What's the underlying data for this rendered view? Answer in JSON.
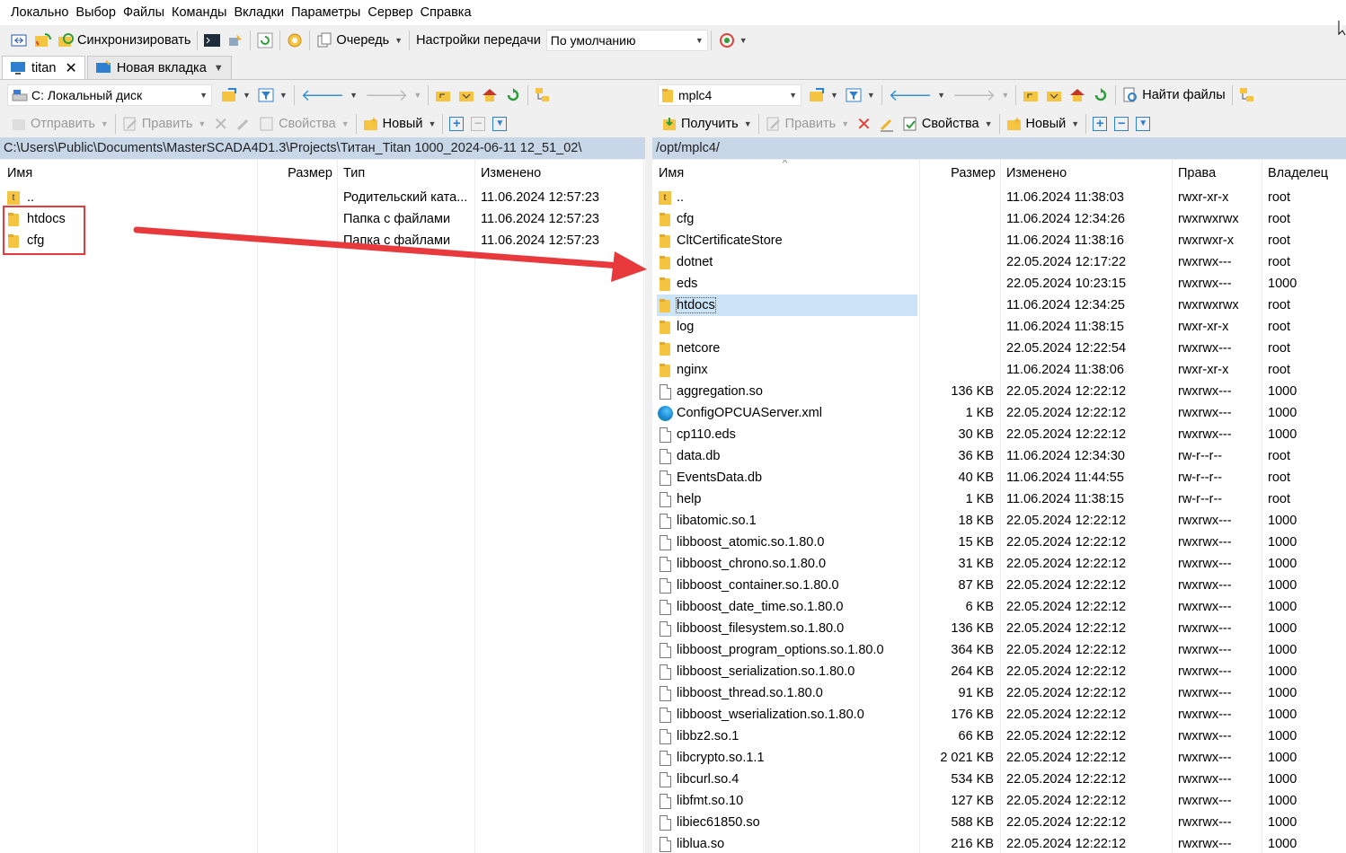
{
  "menu": [
    "Локально",
    "Выбор",
    "Файлы",
    "Команды",
    "Вкладки",
    "Параметры",
    "Сервер",
    "Справка"
  ],
  "main_toolbar": {
    "sync_label": "Синхронизировать",
    "queue_label": "Очередь",
    "transfer_settings_label": "Настройки передачи",
    "transfer_preset": "По умолчанию"
  },
  "tabs": [
    {
      "label": "titan",
      "active": true
    },
    {
      "label": "Новая вкладка",
      "active": false
    }
  ],
  "left": {
    "drive": "C: Локальный диск",
    "send_label": "Отправить",
    "edit_label": "Править",
    "properties_label": "Свойства",
    "new_label": "Новый",
    "path": "C:\\Users\\Public\\Documents\\MasterSCADA4D1.3\\Projects\\Титан_Titan 1000_2024-06-11 12_51_02\\",
    "columns": [
      "Имя",
      "Размер",
      "Тип",
      "Изменено"
    ],
    "rows": [
      {
        "icon": "up-folder-icon",
        "name": "..",
        "size": "",
        "type": "Родительский ката...",
        "modified": "11.06.2024 12:57:23"
      },
      {
        "icon": "folder-icon",
        "name": "htdocs",
        "size": "",
        "type": "Папка с файлами",
        "modified": "11.06.2024 12:57:23"
      },
      {
        "icon": "folder-icon",
        "name": "cfg",
        "size": "",
        "type": "Папка с файлами",
        "modified": "11.06.2024 12:57:23"
      }
    ]
  },
  "right": {
    "folder": "mplc4",
    "find_files_label": "Найти файлы",
    "receive_label": "Получить",
    "edit_label": "Править",
    "properties_label": "Свойства",
    "new_label": "Новый",
    "path": "/opt/mplc4/",
    "columns": [
      "Имя",
      "Размер",
      "Изменено",
      "Права",
      "Владелец"
    ],
    "rows": [
      {
        "icon": "up-folder-icon",
        "name": "..",
        "size": "",
        "modified": "11.06.2024 11:38:03",
        "rights": "rwxr-xr-x",
        "owner": "root"
      },
      {
        "icon": "folder-icon",
        "name": "cfg",
        "size": "",
        "modified": "11.06.2024 12:34:26",
        "rights": "rwxrwxrwx",
        "owner": "root"
      },
      {
        "icon": "folder-icon",
        "name": "CltCertificateStore",
        "size": "",
        "modified": "11.06.2024 11:38:16",
        "rights": "rwxrwxr-x",
        "owner": "root"
      },
      {
        "icon": "folder-icon",
        "name": "dotnet",
        "size": "",
        "modified": "22.05.2024 12:17:22",
        "rights": "rwxrwx---",
        "owner": "root"
      },
      {
        "icon": "folder-icon",
        "name": "eds",
        "size": "",
        "modified": "22.05.2024 10:23:15",
        "rights": "rwxrwx---",
        "owner": "1000"
      },
      {
        "icon": "folder-icon",
        "name": "htdocs",
        "size": "",
        "modified": "11.06.2024 12:34:25",
        "rights": "rwxrwxrwx",
        "owner": "root",
        "selected": true
      },
      {
        "icon": "folder-icon",
        "name": "log",
        "size": "",
        "modified": "11.06.2024 11:38:15",
        "rights": "rwxr-xr-x",
        "owner": "root"
      },
      {
        "icon": "folder-icon",
        "name": "netcore",
        "size": "",
        "modified": "22.05.2024 12:22:54",
        "rights": "rwxrwx---",
        "owner": "root"
      },
      {
        "icon": "folder-icon",
        "name": "nginx",
        "size": "",
        "modified": "11.06.2024 11:38:06",
        "rights": "rwxr-xr-x",
        "owner": "root"
      },
      {
        "icon": "file-icon",
        "name": "aggregation.so",
        "size": "136 KB",
        "modified": "22.05.2024 12:22:12",
        "rights": "rwxrwx---",
        "owner": "1000"
      },
      {
        "icon": "edge-icon",
        "name": "ConfigOPCUAServer.xml",
        "size": "1 KB",
        "modified": "22.05.2024 12:22:12",
        "rights": "rwxrwx---",
        "owner": "1000"
      },
      {
        "icon": "file-icon",
        "name": "cp110.eds",
        "size": "30 KB",
        "modified": "22.05.2024 12:22:12",
        "rights": "rwxrwx---",
        "owner": "1000"
      },
      {
        "icon": "file-icon",
        "name": "data.db",
        "size": "36 KB",
        "modified": "11.06.2024 12:34:30",
        "rights": "rw-r--r--",
        "owner": "root"
      },
      {
        "icon": "file-icon",
        "name": "EventsData.db",
        "size": "40 KB",
        "modified": "11.06.2024 11:44:55",
        "rights": "rw-r--r--",
        "owner": "root"
      },
      {
        "icon": "file-icon",
        "name": "help",
        "size": "1 KB",
        "modified": "11.06.2024 11:38:15",
        "rights": "rw-r--r--",
        "owner": "root"
      },
      {
        "icon": "file-icon",
        "name": "libatomic.so.1",
        "size": "18 KB",
        "modified": "22.05.2024 12:22:12",
        "rights": "rwxrwx---",
        "owner": "1000"
      },
      {
        "icon": "file-icon",
        "name": "libboost_atomic.so.1.80.0",
        "size": "15 KB",
        "modified": "22.05.2024 12:22:12",
        "rights": "rwxrwx---",
        "owner": "1000"
      },
      {
        "icon": "file-icon",
        "name": "libboost_chrono.so.1.80.0",
        "size": "31 KB",
        "modified": "22.05.2024 12:22:12",
        "rights": "rwxrwx---",
        "owner": "1000"
      },
      {
        "icon": "file-icon",
        "name": "libboost_container.so.1.80.0",
        "size": "87 KB",
        "modified": "22.05.2024 12:22:12",
        "rights": "rwxrwx---",
        "owner": "1000"
      },
      {
        "icon": "file-icon",
        "name": "libboost_date_time.so.1.80.0",
        "size": "6 KB",
        "modified": "22.05.2024 12:22:12",
        "rights": "rwxrwx---",
        "owner": "1000"
      },
      {
        "icon": "file-icon",
        "name": "libboost_filesystem.so.1.80.0",
        "size": "136 KB",
        "modified": "22.05.2024 12:22:12",
        "rights": "rwxrwx---",
        "owner": "1000"
      },
      {
        "icon": "file-icon",
        "name": "libboost_program_options.so.1.80.0",
        "size": "364 KB",
        "modified": "22.05.2024 12:22:12",
        "rights": "rwxrwx---",
        "owner": "1000"
      },
      {
        "icon": "file-icon",
        "name": "libboost_serialization.so.1.80.0",
        "size": "264 KB",
        "modified": "22.05.2024 12:22:12",
        "rights": "rwxrwx---",
        "owner": "1000"
      },
      {
        "icon": "file-icon",
        "name": "libboost_thread.so.1.80.0",
        "size": "91 KB",
        "modified": "22.05.2024 12:22:12",
        "rights": "rwxrwx---",
        "owner": "1000"
      },
      {
        "icon": "file-icon",
        "name": "libboost_wserialization.so.1.80.0",
        "size": "176 KB",
        "modified": "22.05.2024 12:22:12",
        "rights": "rwxrwx---",
        "owner": "1000"
      },
      {
        "icon": "file-icon",
        "name": "libbz2.so.1",
        "size": "66 KB",
        "modified": "22.05.2024 12:22:12",
        "rights": "rwxrwx---",
        "owner": "1000"
      },
      {
        "icon": "file-icon",
        "name": "libcrypto.so.1.1",
        "size": "2 021 KB",
        "modified": "22.05.2024 12:22:12",
        "rights": "rwxrwx---",
        "owner": "1000"
      },
      {
        "icon": "file-icon",
        "name": "libcurl.so.4",
        "size": "534 KB",
        "modified": "22.05.2024 12:22:12",
        "rights": "rwxrwx---",
        "owner": "1000"
      },
      {
        "icon": "file-icon",
        "name": "libfmt.so.10",
        "size": "127 KB",
        "modified": "22.05.2024 12:22:12",
        "rights": "rwxrwx---",
        "owner": "1000"
      },
      {
        "icon": "file-icon",
        "name": "libiec61850.so",
        "size": "588 KB",
        "modified": "22.05.2024 12:22:12",
        "rights": "rwxrwx---",
        "owner": "1000"
      },
      {
        "icon": "file-icon",
        "name": "liblua.so",
        "size": "216 KB",
        "modified": "22.05.2024 12:22:12",
        "rights": "rwxrwx---",
        "owner": "1000"
      }
    ]
  },
  "colors": {
    "path_bar": "#c7d7e8",
    "selection": "#cce4f7",
    "annotation_red": "#e8393d"
  }
}
